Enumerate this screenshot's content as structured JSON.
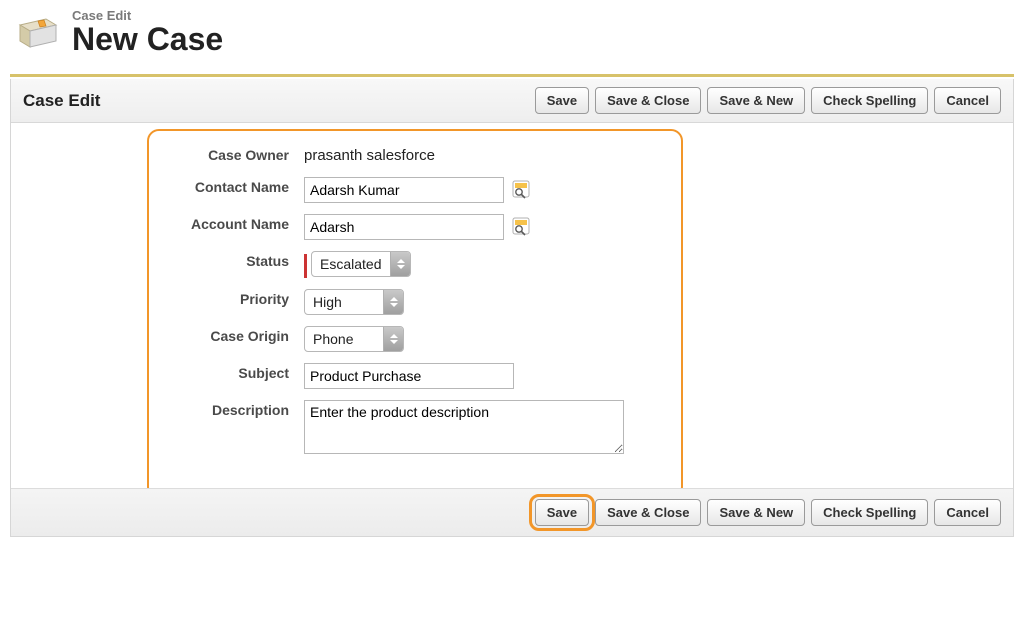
{
  "header": {
    "eyebrow": "Case Edit",
    "title": "New Case"
  },
  "panel": {
    "title": "Case Edit"
  },
  "buttons": {
    "save": "Save",
    "save_close": "Save & Close",
    "save_new": "Save & New",
    "check_spelling": "Check Spelling",
    "cancel": "Cancel"
  },
  "form": {
    "case_owner": {
      "label": "Case Owner",
      "value": "prasanth salesforce"
    },
    "contact_name": {
      "label": "Contact Name",
      "value": "Adarsh Kumar"
    },
    "account_name": {
      "label": "Account Name",
      "value": "Adarsh"
    },
    "status": {
      "label": "Status",
      "value": "Escalated"
    },
    "priority": {
      "label": "Priority",
      "value": "High"
    },
    "case_origin": {
      "label": "Case Origin",
      "value": "Phone"
    },
    "subject": {
      "label": "Subject",
      "value": "Product Purchase"
    },
    "description": {
      "label": "Description",
      "value": "Enter the product description"
    }
  }
}
